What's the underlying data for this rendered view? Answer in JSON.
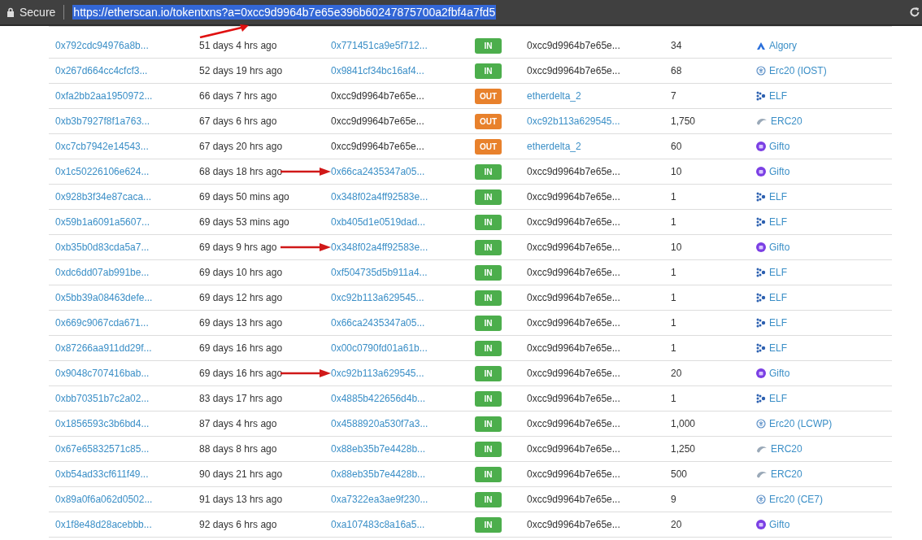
{
  "address_bar": {
    "secure_label": "Secure",
    "url": "https://etherscan.io/tokentxns?a=0xcc9d9964b7e65e396b60247875700a2fbf4a7fd5",
    "url_selected": true,
    "annotated": true
  },
  "rows": [
    {
      "tx": "0x792cdc94976a8b...",
      "age": "51 days 4 hrs ago",
      "from": "0x771451ca9e5f712...",
      "from_link": true,
      "direction": "IN",
      "to": "0xcc9d9964b7e65e...",
      "to_link": false,
      "value": "34",
      "token": "Algory",
      "kind": "peak",
      "annotated": false
    },
    {
      "tx": "0x267d664cc4cfcf3...",
      "age": "52 days 19 hrs ago",
      "from": "0x9841cf34bc16af4...",
      "from_link": true,
      "direction": "IN",
      "to": "0xcc9d9964b7e65e...",
      "to_link": false,
      "value": "68",
      "token": "Erc20 (IOST)",
      "kind": "ring",
      "annotated": false
    },
    {
      "tx": "0xfa2bb2aa1950972...",
      "age": "66 days 7 hrs ago",
      "from": "0xcc9d9964b7e65e...",
      "from_link": false,
      "direction": "OUT",
      "to": "etherdelta_2",
      "to_link": true,
      "value": "7",
      "token": "ELF",
      "kind": "dots",
      "annotated": false
    },
    {
      "tx": "0xb3b7927f8f1a763...",
      "age": "67 days 6 hrs ago",
      "from": "0xcc9d9964b7e65e...",
      "from_link": false,
      "direction": "OUT",
      "to": "0xc92b113a629545...",
      "to_link": true,
      "value": "1,750",
      "token": "ERC20",
      "kind": "swirl",
      "annotated": false
    },
    {
      "tx": "0xc7cb7942e14543...",
      "age": "67 days 20 hrs ago",
      "from": "0xcc9d9964b7e65e...",
      "from_link": false,
      "direction": "OUT",
      "to": "etherdelta_2",
      "to_link": true,
      "value": "60",
      "token": "Gifto",
      "kind": "disc",
      "annotated": false
    },
    {
      "tx": "0x1c50226106e624...",
      "age": "68 days 18 hrs ago",
      "from": "0x66ca2435347a05...",
      "from_link": true,
      "direction": "IN",
      "to": "0xcc9d9964b7e65e...",
      "to_link": false,
      "value": "10",
      "token": "Gifto",
      "kind": "disc",
      "annotated": true
    },
    {
      "tx": "0x928b3f34e87caca...",
      "age": "69 days 50 mins ago",
      "from": "0x348f02a4ff92583e...",
      "from_link": true,
      "direction": "IN",
      "to": "0xcc9d9964b7e65e...",
      "to_link": false,
      "value": "1",
      "token": "ELF",
      "kind": "dots",
      "annotated": false
    },
    {
      "tx": "0x59b1a6091a5607...",
      "age": "69 days 53 mins ago",
      "from": "0xb405d1e0519dad...",
      "from_link": true,
      "direction": "IN",
      "to": "0xcc9d9964b7e65e...",
      "to_link": false,
      "value": "1",
      "token": "ELF",
      "kind": "dots",
      "annotated": false
    },
    {
      "tx": "0xb35b0d83cda5a7...",
      "age": "69 days 9 hrs ago",
      "from": "0x348f02a4ff92583e...",
      "from_link": true,
      "direction": "IN",
      "to": "0xcc9d9964b7e65e...",
      "to_link": false,
      "value": "10",
      "token": "Gifto",
      "kind": "disc",
      "annotated": true
    },
    {
      "tx": "0xdc6dd07ab991be...",
      "age": "69 days 10 hrs ago",
      "from": "0xf504735d5b911a4...",
      "from_link": true,
      "direction": "IN",
      "to": "0xcc9d9964b7e65e...",
      "to_link": false,
      "value": "1",
      "token": "ELF",
      "kind": "dots",
      "annotated": false
    },
    {
      "tx": "0x5bb39a08463defe...",
      "age": "69 days 12 hrs ago",
      "from": "0xc92b113a629545...",
      "from_link": true,
      "direction": "IN",
      "to": "0xcc9d9964b7e65e...",
      "to_link": false,
      "value": "1",
      "token": "ELF",
      "kind": "dots",
      "annotated": false
    },
    {
      "tx": "0x669c9067cda671...",
      "age": "69 days 13 hrs ago",
      "from": "0x66ca2435347a05...",
      "from_link": true,
      "direction": "IN",
      "to": "0xcc9d9964b7e65e...",
      "to_link": false,
      "value": "1",
      "token": "ELF",
      "kind": "dots",
      "annotated": false
    },
    {
      "tx": "0x87266aa911dd29f...",
      "age": "69 days 16 hrs ago",
      "from": "0x00c0790fd01a61b...",
      "from_link": true,
      "direction": "IN",
      "to": "0xcc9d9964b7e65e...",
      "to_link": false,
      "value": "1",
      "token": "ELF",
      "kind": "dots",
      "annotated": false
    },
    {
      "tx": "0x9048c707416bab...",
      "age": "69 days 16 hrs ago",
      "from": "0xc92b113a629545...",
      "from_link": true,
      "direction": "IN",
      "to": "0xcc9d9964b7e65e...",
      "to_link": false,
      "value": "20",
      "token": "Gifto",
      "kind": "disc",
      "annotated": true
    },
    {
      "tx": "0xbb70351b7c2a02...",
      "age": "83 days 17 hrs ago",
      "from": "0x4885b422656d4b...",
      "from_link": true,
      "direction": "IN",
      "to": "0xcc9d9964b7e65e...",
      "to_link": false,
      "value": "1",
      "token": "ELF",
      "kind": "dots",
      "annotated": false
    },
    {
      "tx": "0x1856593c3b6bd4...",
      "age": "87 days 4 hrs ago",
      "from": "0x4588920a530f7a3...",
      "from_link": true,
      "direction": "IN",
      "to": "0xcc9d9964b7e65e...",
      "to_link": false,
      "value": "1,000",
      "token": "Erc20 (LCWP)",
      "kind": "ring",
      "annotated": false
    },
    {
      "tx": "0x67e65832571c85...",
      "age": "88 days 8 hrs ago",
      "from": "0x88eb35b7e4428b...",
      "from_link": true,
      "direction": "IN",
      "to": "0xcc9d9964b7e65e...",
      "to_link": false,
      "value": "1,250",
      "token": "ERC20",
      "kind": "swirl",
      "annotated": false
    },
    {
      "tx": "0xb54ad33cf611f49...",
      "age": "90 days 21 hrs ago",
      "from": "0x88eb35b7e4428b...",
      "from_link": true,
      "direction": "IN",
      "to": "0xcc9d9964b7e65e...",
      "to_link": false,
      "value": "500",
      "token": "ERC20",
      "kind": "swirl",
      "annotated": false
    },
    {
      "tx": "0x89a0f6a062d0502...",
      "age": "91 days 13 hrs ago",
      "from": "0xa7322ea3ae9f230...",
      "from_link": true,
      "direction": "IN",
      "to": "0xcc9d9964b7e65e...",
      "to_link": false,
      "value": "9",
      "token": "Erc20 (CE7)",
      "kind": "ring",
      "annotated": false
    },
    {
      "tx": "0x1f8e48d28acebbb...",
      "age": "92 days 6 hrs ago",
      "from": "0xa107483c8a16a5...",
      "from_link": true,
      "direction": "IN",
      "to": "0xcc9d9964b7e65e...",
      "to_link": false,
      "value": "20",
      "token": "Gifto",
      "kind": "disc",
      "annotated": false
    }
  ]
}
